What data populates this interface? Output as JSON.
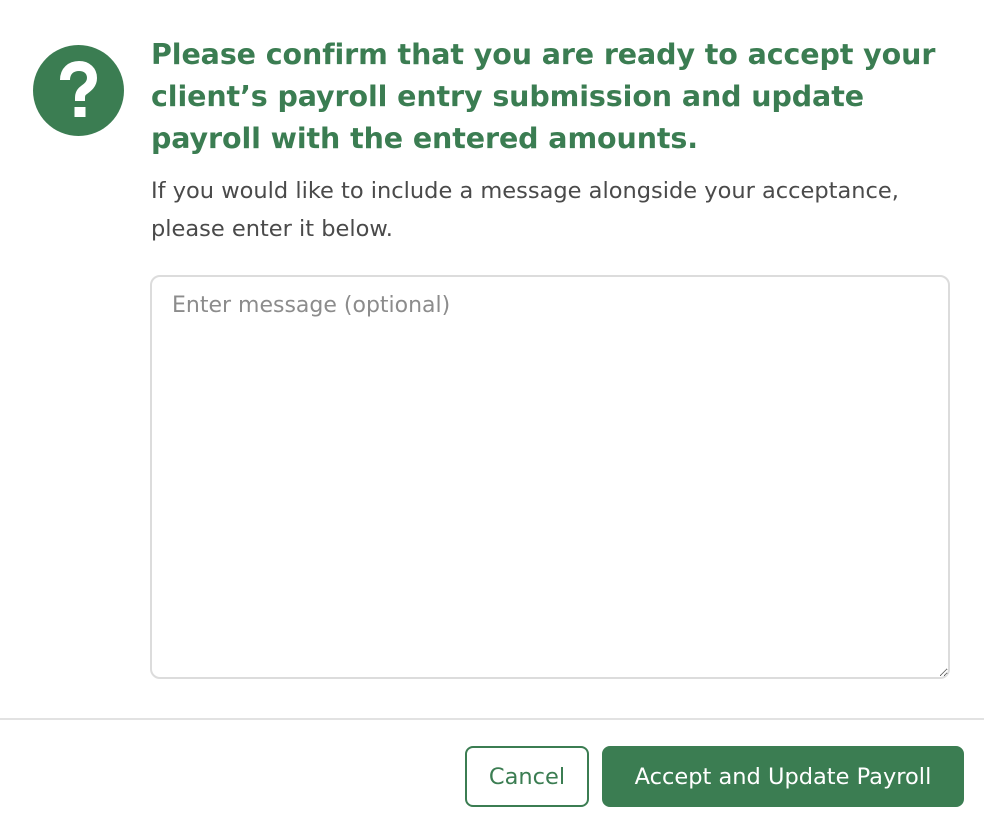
{
  "dialog": {
    "icon": "question-mark-icon",
    "title": "Please confirm that you are ready to accept your client’s payroll entry submission and update payroll with the entered amounts.",
    "subtitle": "If you would like to include a message alongside your acceptance, please enter it below.",
    "message": {
      "value": "",
      "placeholder": "Enter message (optional)"
    },
    "buttons": {
      "cancel_label": "Cancel",
      "accept_label": "Accept and Update Payroll"
    }
  },
  "colors": {
    "accent": "#3b7d52",
    "text": "#4a4a4a",
    "placeholder": "#8c8c8c",
    "border": "#dcdcdc",
    "divider": "#e2e2e2"
  }
}
